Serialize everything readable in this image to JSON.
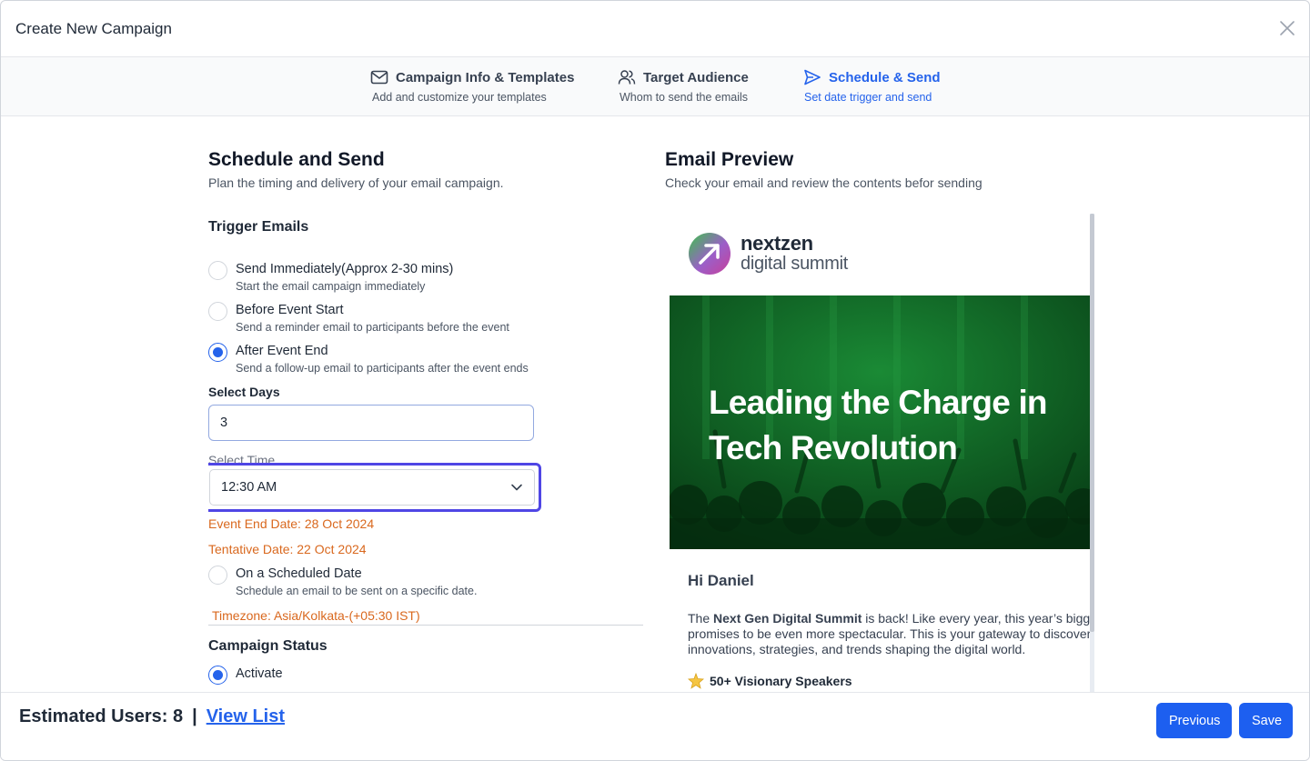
{
  "header": {
    "title": "Create New Campaign"
  },
  "steps": [
    {
      "label": "Campaign Info & Templates",
      "sub": "Add and customize your templates",
      "icon": "mail-icon"
    },
    {
      "label": "Target Audience",
      "sub": "Whom to send the emails",
      "icon": "users-icon"
    },
    {
      "label": "Schedule & Send",
      "sub": "Set date trigger and send",
      "icon": "send-icon",
      "active": true
    }
  ],
  "schedule": {
    "title": "Schedule and Send",
    "subtitle": "Plan the timing and delivery of your email campaign.",
    "trigger_title": "Trigger Emails",
    "options": [
      {
        "title": "Send Immediately(Approx 2-30 mins)",
        "desc": "Start the email campaign immediately",
        "checked": false
      },
      {
        "title": "Before Event Start",
        "desc": "Send a reminder email to participants before the event",
        "checked": false
      },
      {
        "title": "After Event End",
        "desc": "Send a follow-up email to participants after the event ends",
        "checked": true
      }
    ],
    "days_label": "Select Days",
    "days_value": "3",
    "time_label": "Select Time",
    "time_value": "12:30 AM",
    "event_end": "Event End Date: 28 Oct 2024",
    "tentative": "Tentative Date: 22 Oct 2024",
    "scheduled_option": {
      "title": "On a Scheduled Date",
      "desc": "Schedule an email to be sent on a specific date.",
      "checked": false
    },
    "timezone": "Timezone: Asia/Kolkata-(+05:30 IST)",
    "status_title": "Campaign Status",
    "status_option": "Activate"
  },
  "preview": {
    "title": "Email Preview",
    "subtitle": "Check your email and review the contents befor sending",
    "brand_line1": "nextzen",
    "brand_line2": "digital summit",
    "headline": "Leading the Charge in Tech Revolution",
    "greeting": "Hi Daniel",
    "para_prefix": "The ",
    "para_bold": "Next Gen Digital Summit",
    "para_rest1": " is back! Like every year, this year’s bigg",
    "para_line2": "promises to be even more spectacular. This is your gateway to discover",
    "para_line3": "innovations, strategies, and trends shaping the digital world.",
    "bullet": "50+ Visionary Speakers"
  },
  "footer": {
    "estimated": "Estimated Users: 8",
    "separator": "|",
    "view_list": "View List",
    "previous": "Previous",
    "save": "Save"
  },
  "colors": {
    "accent": "#1d5ff0",
    "focus": "#4f46e5",
    "warning": "#d9681e",
    "hero": "#0b4d1d"
  }
}
